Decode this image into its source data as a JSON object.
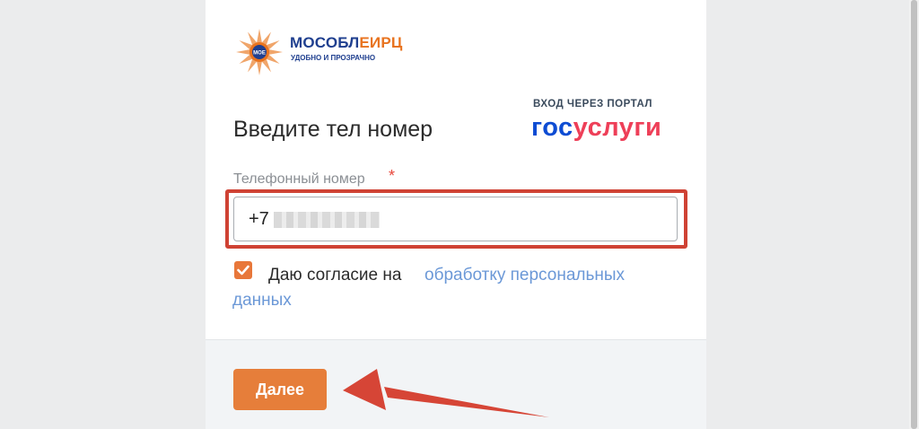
{
  "brand": {
    "name_part1": "МОСОБЛ",
    "name_part2": "ЕИРЦ",
    "tagline": "УДОБНО И ПРОЗРАЧНО",
    "logo_icon": "mosobleirc-logo-icon",
    "logo_initials": "МОЕ"
  },
  "form": {
    "title": "Введите тел номер",
    "phone_label": "Телефонный номер",
    "required_mark": "*",
    "phone_value": "+7",
    "consent_text": "Даю согласие на",
    "consent_link_line1": "обработку персональных",
    "consent_link_line2": "данных",
    "consent_checked": true
  },
  "gosuslugi": {
    "caption": "ВХОД ЧЕРЕЗ ПОРТАЛ",
    "logo_blue": "гос",
    "logo_red": "услуги"
  },
  "footer": {
    "next_label": "Далее"
  },
  "annotations": {
    "highlight_color": "#cf4234",
    "arrow_icon": "red-pointer-arrow-icon"
  },
  "colors": {
    "accent_orange": "#e67e3a",
    "link_blue": "#6b98d7",
    "brand_blue": "#1f3f8f",
    "gos_blue": "#0d4cd3",
    "gos_red": "#ee3f58"
  }
}
